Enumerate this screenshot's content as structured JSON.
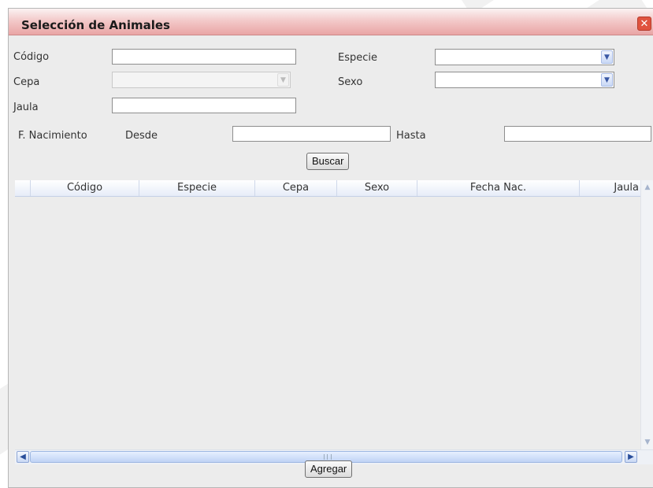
{
  "dialog": {
    "title": "Selección de Animales",
    "close_icon": "close-icon"
  },
  "form": {
    "codigo_label": "Código",
    "codigo_value": "",
    "especie_label": "Especie",
    "especie_selected": "",
    "cepa_label": "Cepa",
    "cepa_selected": "",
    "cepa_disabled": true,
    "sexo_label": "Sexo",
    "sexo_selected": "",
    "jaula_label": "Jaula",
    "jaula_value": "",
    "fnac_label": "F. Nacimiento",
    "desde_label": "Desde",
    "desde_value": "",
    "hasta_label": "Hasta",
    "hasta_value": "",
    "buscar_label": "Buscar"
  },
  "table": {
    "columns": [
      "Código",
      "Especie",
      "Cepa",
      "Sexo",
      "Fecha Nac.",
      "Jaula"
    ],
    "rows": []
  },
  "footer": {
    "agregar_label": "Agregar"
  },
  "colors": {
    "title_bar": "#e9a5a5",
    "close_button": "#e0533f",
    "dialog_bg": "#ececec",
    "grid_header": "#e6ecf8"
  }
}
